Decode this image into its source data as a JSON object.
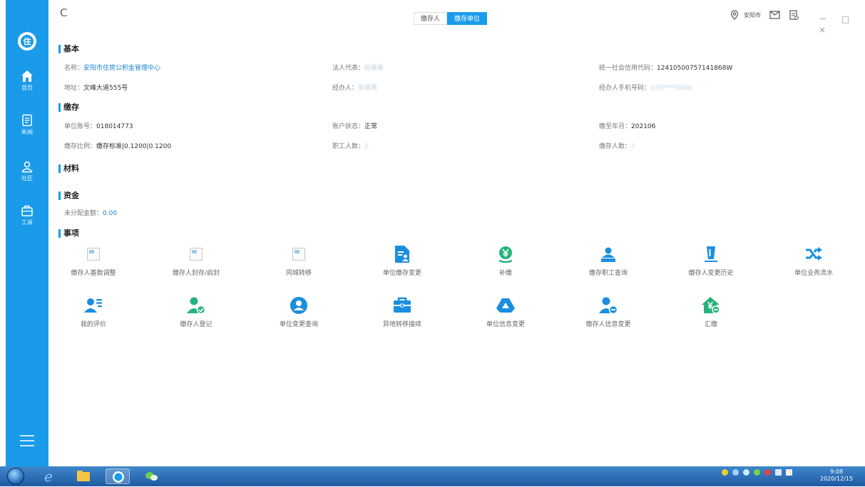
{
  "topbar": {
    "tabs": [
      {
        "label": "缴存人",
        "active": false
      },
      {
        "label": "缴存单位",
        "active": true
      }
    ],
    "city": "安阳市",
    "window_controls": "－ □ ×"
  },
  "sidebar": {
    "logo_char": "住",
    "items": [
      {
        "label": "首页",
        "icon": "home-icon"
      },
      {
        "label": "新闻",
        "icon": "news-icon"
      },
      {
        "label": "社区",
        "icon": "community-icon"
      },
      {
        "label": "工具",
        "icon": "toolbox-icon"
      }
    ]
  },
  "sections": {
    "basic": "基本",
    "deposit": "缴存",
    "materials": "材料",
    "funds": "资金",
    "items": "事项"
  },
  "basic": {
    "name_label": "名称：",
    "name_value": "安阳市住房公积金管理中心",
    "legal_rep_label": "法人代表：",
    "legal_rep_value": "赵某某",
    "credit_code_label": "统一社会信用代码：",
    "credit_code_value": "12410500757141868W",
    "address_label": "地址：",
    "address_value": "文峰大道555号",
    "handler_label": "经办人：",
    "handler_value": "张某某",
    "handler_phone_label": "经办人手机号码：",
    "handler_phone_value": "155****5826"
  },
  "deposit": {
    "account_label": "单位账号：",
    "account_value": "018014773",
    "status_label": "账户状态：",
    "status_value": "正常",
    "paid_until_label": "缴至年月：",
    "paid_until_value": "202106",
    "ratio_label": "缴存比例：",
    "ratio_value": "缴存标准|0.1200|0.1200",
    "staff_count_label": "职工人数：",
    "staff_count_value": "2",
    "depositor_count_label": "缴存人数：",
    "depositor_count_value": "2"
  },
  "funds": {
    "unallocated_label": "未分配金额：",
    "unallocated_value": "0.00"
  },
  "actions_row1": [
    {
      "label": "缴存人基数调整",
      "icon": "broken-image-icon"
    },
    {
      "label": "缴存人封存/启封",
      "icon": "broken-image-icon"
    },
    {
      "label": "同城转移",
      "icon": "broken-image-icon"
    },
    {
      "label": "单位缴存变更",
      "icon": "document-person-icon"
    },
    {
      "label": "补缴",
      "icon": "yuan-coin-icon"
    },
    {
      "label": "缴存职工查询",
      "icon": "staff-query-icon"
    },
    {
      "label": "缴存人变更历史",
      "icon": "bucket-history-icon"
    },
    {
      "label": "单位业务流水",
      "icon": "shuffle-icon"
    }
  ],
  "actions_row2": [
    {
      "label": "我的评价",
      "icon": "user-list-icon"
    },
    {
      "label": "缴存人登记",
      "icon": "user-check-icon"
    },
    {
      "label": "单位变更查询",
      "icon": "user-circle-icon"
    },
    {
      "label": "异地转移接续",
      "icon": "briefcase-icon"
    },
    {
      "label": "单位信息变更",
      "icon": "drive-icon"
    },
    {
      "label": "缴存人信息变更",
      "icon": "user-edit-icon"
    },
    {
      "label": "汇缴",
      "icon": "house-yuan-icon"
    }
  ],
  "taskbar": {
    "time": "9:08",
    "date": "2020/12/15"
  },
  "colors": {
    "accent": "#1a9bea",
    "icon_blue": "#1a8fe0",
    "icon_green": "#27b27c"
  }
}
